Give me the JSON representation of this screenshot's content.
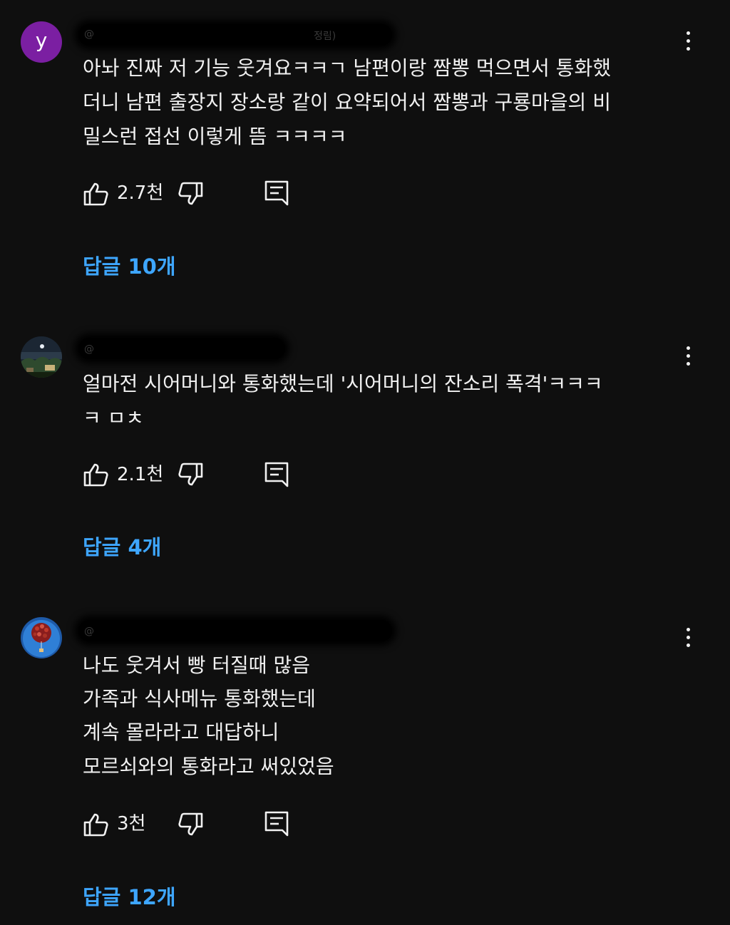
{
  "comments": [
    {
      "avatar_letter": "y",
      "author_peek_left": "@",
      "author_peek_right": "정림)",
      "lines": [
        "아놔 진짜 저 기능 웃겨요ㅋㅋㄱ 남편이랑 짬뽕 먹으면서 통화했",
        "더니 남편 출장지 장소랑 같이 요약되어서 짬뽕과 구룡마을의 비",
        "밀스런 접선 이렇게 뜸 ㅋㅋㅋㅋ"
      ],
      "likes": "2.7천",
      "replies": "답글 10개"
    },
    {
      "avatar_icon": "night-landscape-avatar-icon",
      "author_peek_left": "@",
      "lines": [
        "얼마전 시어머니와 통화했는데 '시어머니의 잔소리 폭격'ㅋㅋㅋ",
        "ㅋ ㅁㅊ"
      ],
      "likes": "2.1천",
      "replies": "답글 4개"
    },
    {
      "avatar_icon": "balloons-avatar-icon",
      "author_peek_left": "@",
      "lines": [
        "나도 웃겨서  빵 터질때 많음",
        "가족과 식사메뉴 통화했는데",
        "계속 몰라라고 대답하니",
        "모르쇠와의 통화라고 써있었음"
      ],
      "likes": "3천",
      "replies": "답글 12개"
    }
  ],
  "colors": {
    "background": "#0f0f0f",
    "text": "#f1f1f1",
    "reply_link": "#3ea6ff",
    "avatar_purple": "#7b1fa2"
  }
}
